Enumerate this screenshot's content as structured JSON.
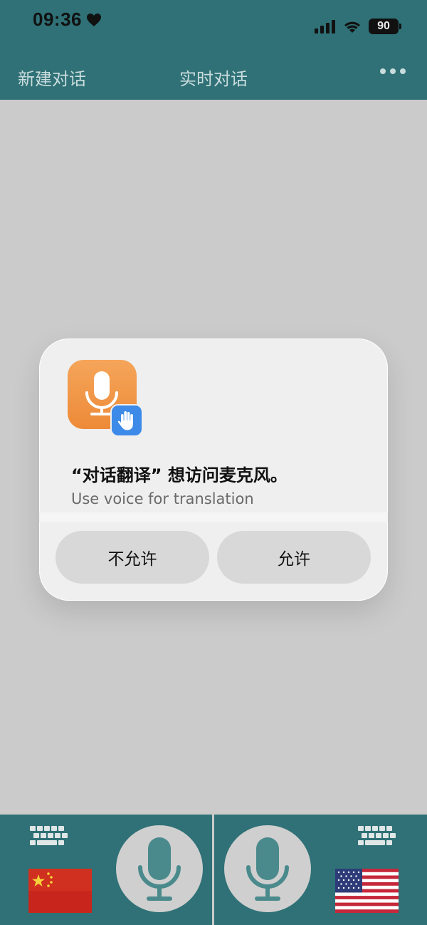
{
  "status_bar": {
    "time": "09:36",
    "battery": "90"
  },
  "nav": {
    "left_label": "新建对话",
    "title": "实时对话"
  },
  "dialog": {
    "title": "“对话翻译” 想访问麦克风。",
    "message": "Use voice for translation",
    "deny_label": "不允许",
    "allow_label": "允许"
  },
  "colors": {
    "bar": "#2f7176",
    "background": "#cbcbcb",
    "app_icon": "#ef8f3e",
    "permission_badge": "#3d8ae8"
  },
  "icons": [
    "heart-icon",
    "cellular-signal-icon",
    "wifi-icon",
    "battery-icon",
    "more-icon",
    "microphone-icon",
    "hand-icon",
    "keyboard-icon",
    "china-flag-icon",
    "usa-flag-icon"
  ]
}
